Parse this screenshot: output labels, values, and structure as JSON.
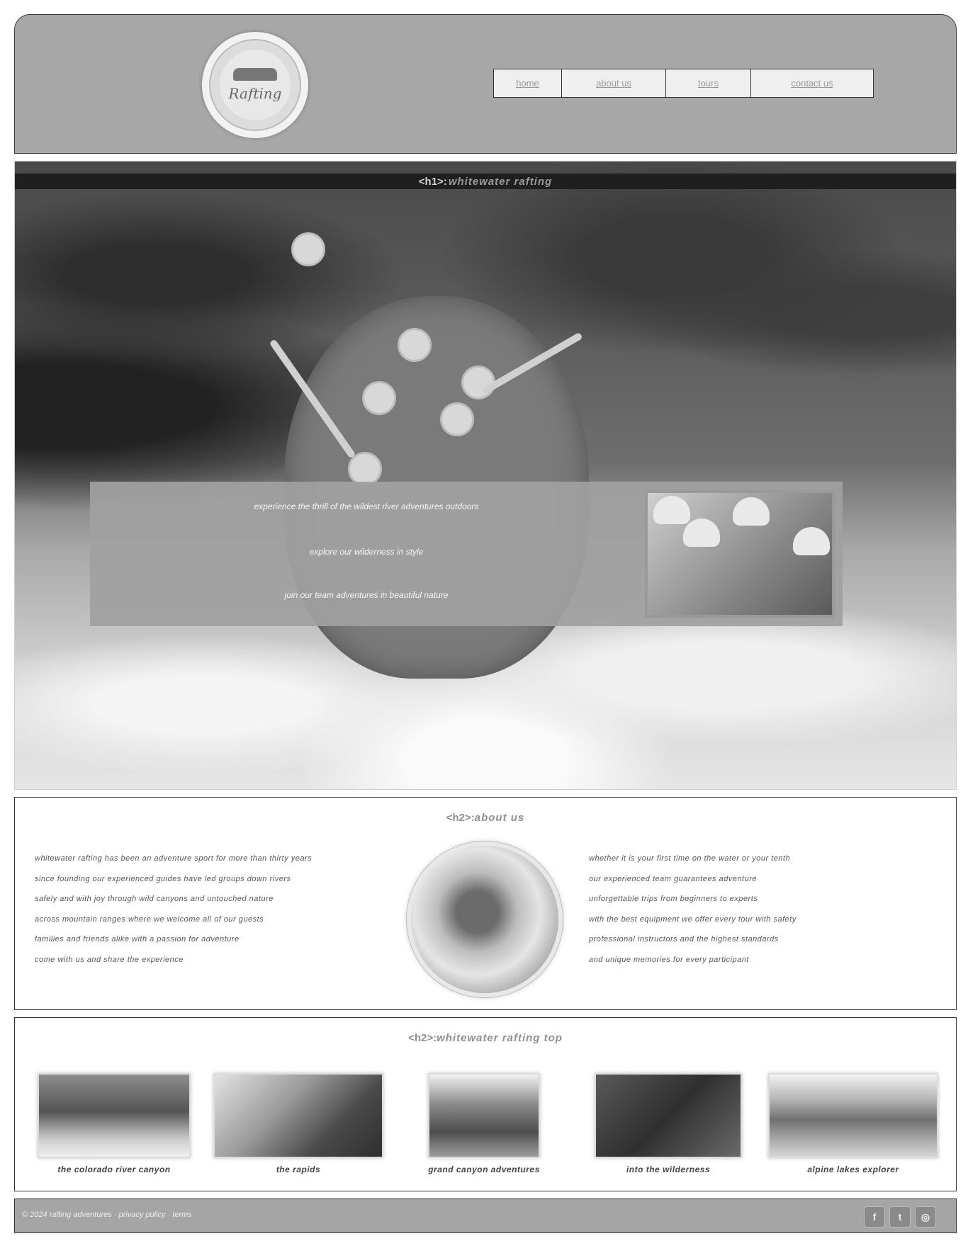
{
  "header": {
    "logo_text": "Rafting",
    "nav": [
      {
        "label": "home"
      },
      {
        "label": "about us"
      },
      {
        "label": "tours"
      },
      {
        "label": "contact us"
      }
    ]
  },
  "hero": {
    "title_tag": "<h1>:",
    "title": "whitewater rafting",
    "panel_lines": [
      "experience the thrill of the wildest river adventures outdoors",
      "explore our wilderness in style",
      "join our team adventures in beautiful nature"
    ]
  },
  "about": {
    "heading_tag": "<h2>:",
    "heading": "about us",
    "left_paragraph": [
      "whitewater rafting has been an adventure sport for more than thirty years",
      "since founding our experienced guides have led groups down rivers",
      "safely and with joy through wild canyons and untouched nature",
      "across mountain ranges where we welcome all of our guests",
      "families and friends alike with a passion for adventure",
      "come with us and share the experience"
    ],
    "right_paragraph": [
      "whether it is your first time on the water or your tenth",
      "our experienced team guarantees adventure",
      "unforgettable trips from beginners to experts",
      "with the best equipment we offer every tour with safety",
      "professional instructors and the highest standards",
      "and unique memories for every participant"
    ]
  },
  "destinations": {
    "heading_tag": "<h2>:",
    "heading": "whitewater rafting top",
    "items": [
      {
        "caption": "the colorado river canyon"
      },
      {
        "caption": "the rapids"
      },
      {
        "caption": "grand canyon adventures"
      },
      {
        "caption": "into the wilderness"
      },
      {
        "caption": "alpine lakes explorer"
      }
    ]
  },
  "footer": {
    "text": "© 2024 rafting adventures · privacy policy · terms",
    "social": [
      {
        "icon": "facebook-icon",
        "glyph": "f"
      },
      {
        "icon": "twitter-icon",
        "glyph": "t"
      },
      {
        "icon": "instagram-icon",
        "glyph": "◎"
      }
    ]
  }
}
